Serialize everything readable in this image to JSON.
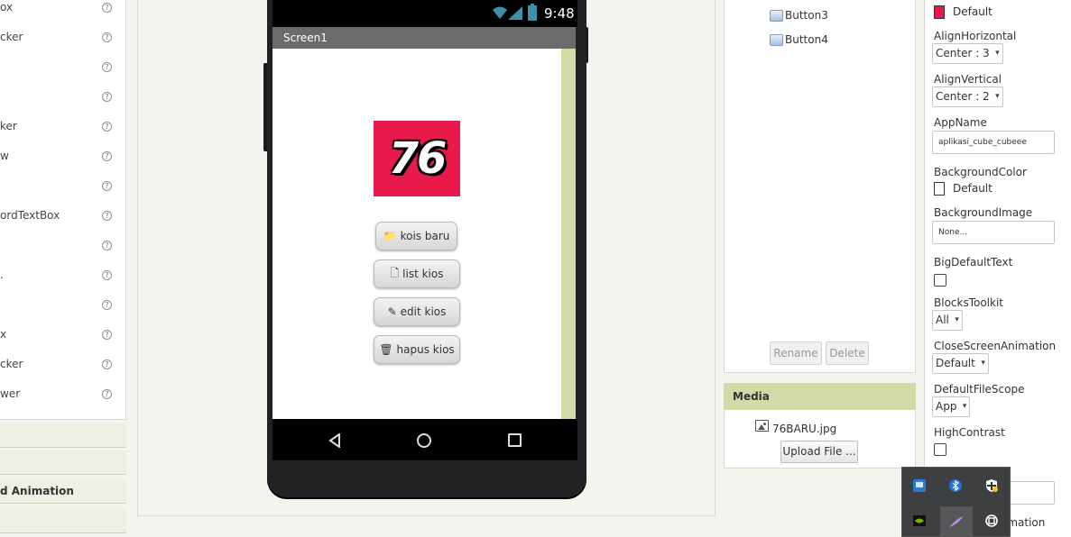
{
  "palette": {
    "items": [
      {
        "label": "ox"
      },
      {
        "label": "cker"
      },
      {
        "label": ""
      },
      {
        "label": ""
      },
      {
        "label": "ker"
      },
      {
        "label": "w"
      },
      {
        "label": ""
      },
      {
        "label": "ordTextBox"
      },
      {
        "label": ""
      },
      {
        "label": "."
      },
      {
        "label": ""
      },
      {
        "label": "x"
      },
      {
        "label": "cker"
      },
      {
        "label": "wer"
      }
    ],
    "help_glyph": "?",
    "drawers": [
      {
        "label": ""
      },
      {
        "label": ""
      },
      {
        "label": "d Animation"
      },
      {
        "label": ""
      }
    ]
  },
  "phone": {
    "status_time": "9:48",
    "screen_title": "Screen1",
    "logo_text": "76",
    "logo_color": "#e8194b",
    "buttons": [
      {
        "label": "kois baru",
        "icon": "folder-icon"
      },
      {
        "label": "list kios",
        "icon": "document-icon"
      },
      {
        "label": "edit kios",
        "icon": "pencil-icon"
      },
      {
        "label": "hapus kios",
        "icon": "trash-icon"
      }
    ]
  },
  "components": {
    "tree": [
      {
        "label": "Button3"
      },
      {
        "label": "Button4"
      }
    ],
    "rename_label": "Rename",
    "delete_label": "Delete"
  },
  "media": {
    "header": "Media",
    "file": "76BARU.jpg",
    "upload_label": "Upload File ..."
  },
  "properties": {
    "accent_color_value": "Default",
    "accent_color": "#e8194b",
    "align_horizontal_label": "AlignHorizontal",
    "align_horizontal_value": "Center : 3",
    "align_vertical_label": "AlignVertical",
    "align_vertical_value": "Center : 2",
    "app_name_label": "AppName",
    "app_name_value": "aplikasi_cube_cubeee",
    "background_color_label": "BackgroundColor",
    "background_color_value": "Default",
    "background_image_label": "BackgroundImage",
    "background_image_value": "None...",
    "big_default_text_label": "BigDefaultText",
    "blocks_toolkit_label": "BlocksToolkit",
    "blocks_toolkit_value": "All",
    "close_screen_animation_label": "CloseScreenAnimation",
    "close_screen_animation_value": "Default",
    "default_file_scope_label": "DefaultFileScope",
    "default_file_scope_value": "App",
    "high_contrast_label": "HighContrast",
    "partial_animation_label": "imation"
  },
  "tray": {
    "icons": [
      "network-icon",
      "bluetooth-icon",
      "security-icon",
      "nvidia-icon",
      "feather-icon",
      "sync-icon"
    ]
  }
}
